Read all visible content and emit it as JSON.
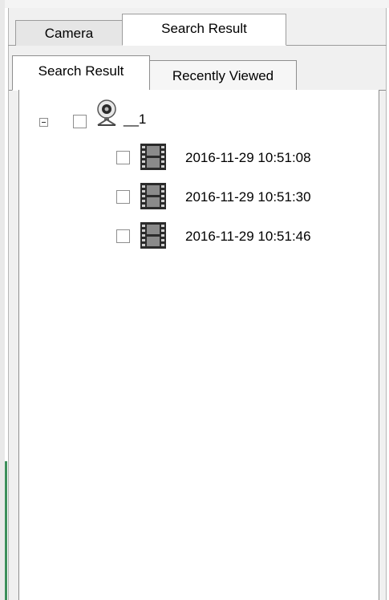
{
  "top_tabs": [
    {
      "label": "Camera",
      "selected": false
    },
    {
      "label": "Search Result",
      "selected": true
    }
  ],
  "sub_tabs": [
    {
      "label": "Search Result",
      "selected": true
    },
    {
      "label": "Recently Viewed",
      "selected": false
    }
  ],
  "tree": {
    "root": {
      "label": "__1",
      "icon": "webcam-icon",
      "expanded": true,
      "checked": false,
      "children": [
        {
          "label": "2016-11-29 10:51:08",
          "icon": "film-icon",
          "checked": false
        },
        {
          "label": "2016-11-29 10:51:30",
          "icon": "film-icon",
          "checked": false
        },
        {
          "label": "2016-11-29 10:51:46",
          "icon": "film-icon",
          "checked": false
        }
      ]
    }
  },
  "colors": {
    "panel_bg": "#f0f0f0",
    "tree_bg": "#ffffff",
    "tab_border": "#9c9c9c",
    "side_accent": "#3c8f5a"
  }
}
